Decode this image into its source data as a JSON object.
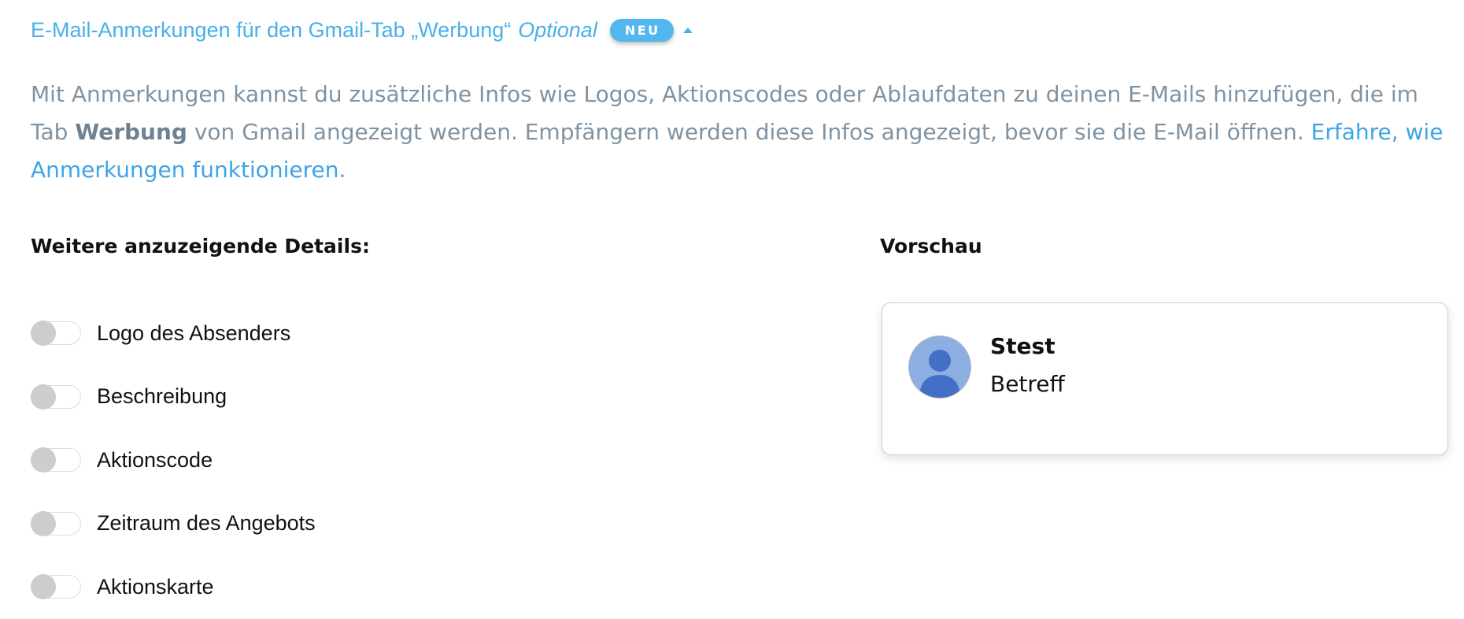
{
  "annotations_section": {
    "title": "E-Mail-Anmerkungen für den Gmail-Tab „Werbung“",
    "optional_label": "Optional",
    "badge": "NEU",
    "description": {
      "part1": "Mit Anmerkungen kannst du zusätzliche Infos wie Logos, Aktionscodes oder Ablaufdaten zu deinen E-Mails hinzufügen, die im Tab ",
      "bold": "Werbung",
      "part2": " von Gmail angezeigt werden. Empfängern werden diese Infos angezeigt, bevor sie die E-Mail öffnen. ",
      "link": "Erfahre, wie Anmerkungen funktionieren",
      "end": "."
    }
  },
  "details": {
    "heading": "Weitere anzuzeigende Details:",
    "toggles": [
      {
        "label": "Logo des Absenders",
        "enabled": false
      },
      {
        "label": "Beschreibung",
        "enabled": false
      },
      {
        "label": "Aktionscode",
        "enabled": false
      },
      {
        "label": "Zeitraum des Angebots",
        "enabled": false
      },
      {
        "label": "Aktionskarte",
        "enabled": false
      }
    ]
  },
  "preview": {
    "heading": "Vorschau",
    "sender": "Stest",
    "subject": "Betreff",
    "avatar_icon": "user-silhouette-icon"
  },
  "colors": {
    "accent": "#4ab0e8",
    "link": "#3fa4e6",
    "muted_text": "#7f93a3",
    "toggle_off": "#cdcdcd",
    "avatar_bg": "#8daee0",
    "avatar_figure": "#4270c6"
  }
}
